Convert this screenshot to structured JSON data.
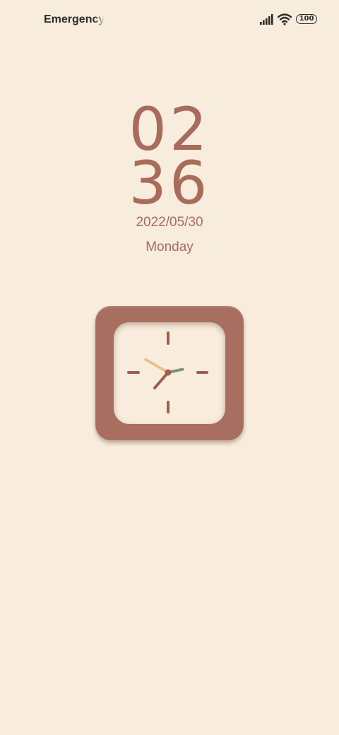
{
  "status_bar": {
    "carrier_text": "Emergency c",
    "battery_level": "100",
    "icons": [
      "signal-icon",
      "wifi-icon",
      "battery-icon"
    ]
  },
  "lockscreen": {
    "hours": "02",
    "minutes": "36",
    "date": "2022/05/30",
    "weekday": "Monday"
  },
  "clock_widget": {
    "hour": 2,
    "minute": 36,
    "second": 50,
    "colors": {
      "frame": "#a86e60",
      "face": "#f8ecdc",
      "ticks": "#a05d50",
      "hour_hand": "#7d9472",
      "minute_hand": "#a05d50",
      "second_hand": "#e6bf7c"
    }
  },
  "colors": {
    "background": "#f8ecdd",
    "accent": "#a96b5c",
    "status_text": "#2b2b2b"
  }
}
